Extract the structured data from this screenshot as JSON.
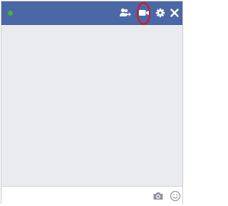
{
  "chat": {
    "title": "",
    "status": "online",
    "status_color": "#42b72a",
    "header_color": "#4b67a6",
    "body_color": "#e9ebee",
    "highlight_color": "#e0101a"
  },
  "toolbar": {
    "icons": [
      "add-friend-icon",
      "video-call-icon",
      "settings-icon",
      "close-icon"
    ]
  },
  "composer": {
    "value": "",
    "placeholder": "",
    "icons": [
      "camera-icon",
      "emoji-icon"
    ]
  }
}
